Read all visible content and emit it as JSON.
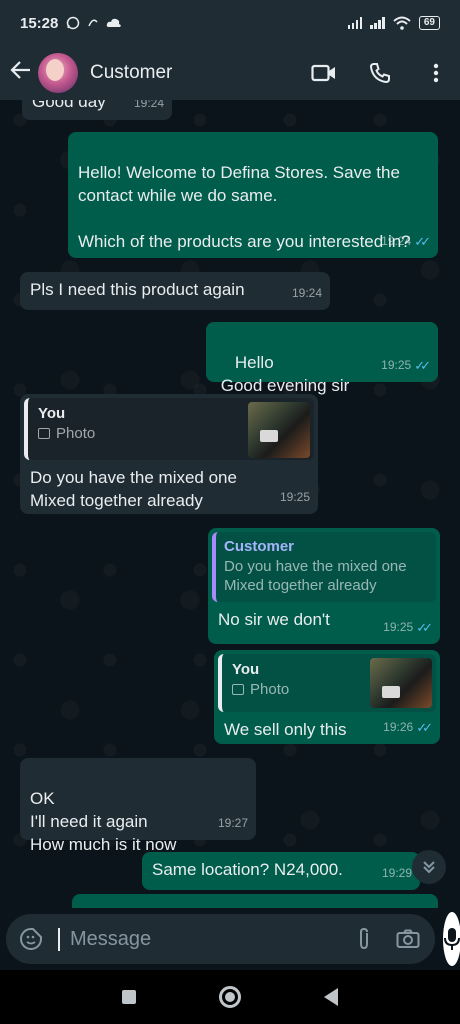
{
  "status_bar": {
    "time": "15:28",
    "battery": "69"
  },
  "header": {
    "contact_name": "Customer"
  },
  "messages": [
    {
      "text_partial": "Good day",
      "time": "19:24"
    },
    {
      "text": "Hello! Welcome to Defina Stores. Save the contact while we do same.\n\nWhich of the products are you interested in?",
      "time": "19:24"
    },
    {
      "text": "Pls I need this product again",
      "time": "19:24"
    },
    {
      "text": "Hello\n Good evening sir",
      "time": "19:25"
    },
    {
      "quote_author": "You",
      "quote_text": "Photo",
      "text": "Do you have the mixed one\nMixed together already",
      "time": "19:25"
    },
    {
      "quote_author": "Customer",
      "quote_text": "Do you have the mixed one\nMixed together already",
      "text": "No sir we don't",
      "time": "19:25"
    },
    {
      "quote_author": "You",
      "quote_text": "Photo",
      "text": "We sell only this",
      "time": "19:26"
    },
    {
      "text": "OK\nI'll need it again\nHow much is it now",
      "time": "19:27"
    },
    {
      "text": "Same location? N24,000.",
      "time": "19:29"
    }
  ],
  "input": {
    "placeholder": "Message"
  },
  "colors": {
    "header_bg": "#1f2c34",
    "incoming_bubble": "#1f2c34",
    "outgoing_bubble": "#005c4b",
    "read_ticks": "#53bdeb",
    "chat_bg": "#0b141a"
  }
}
